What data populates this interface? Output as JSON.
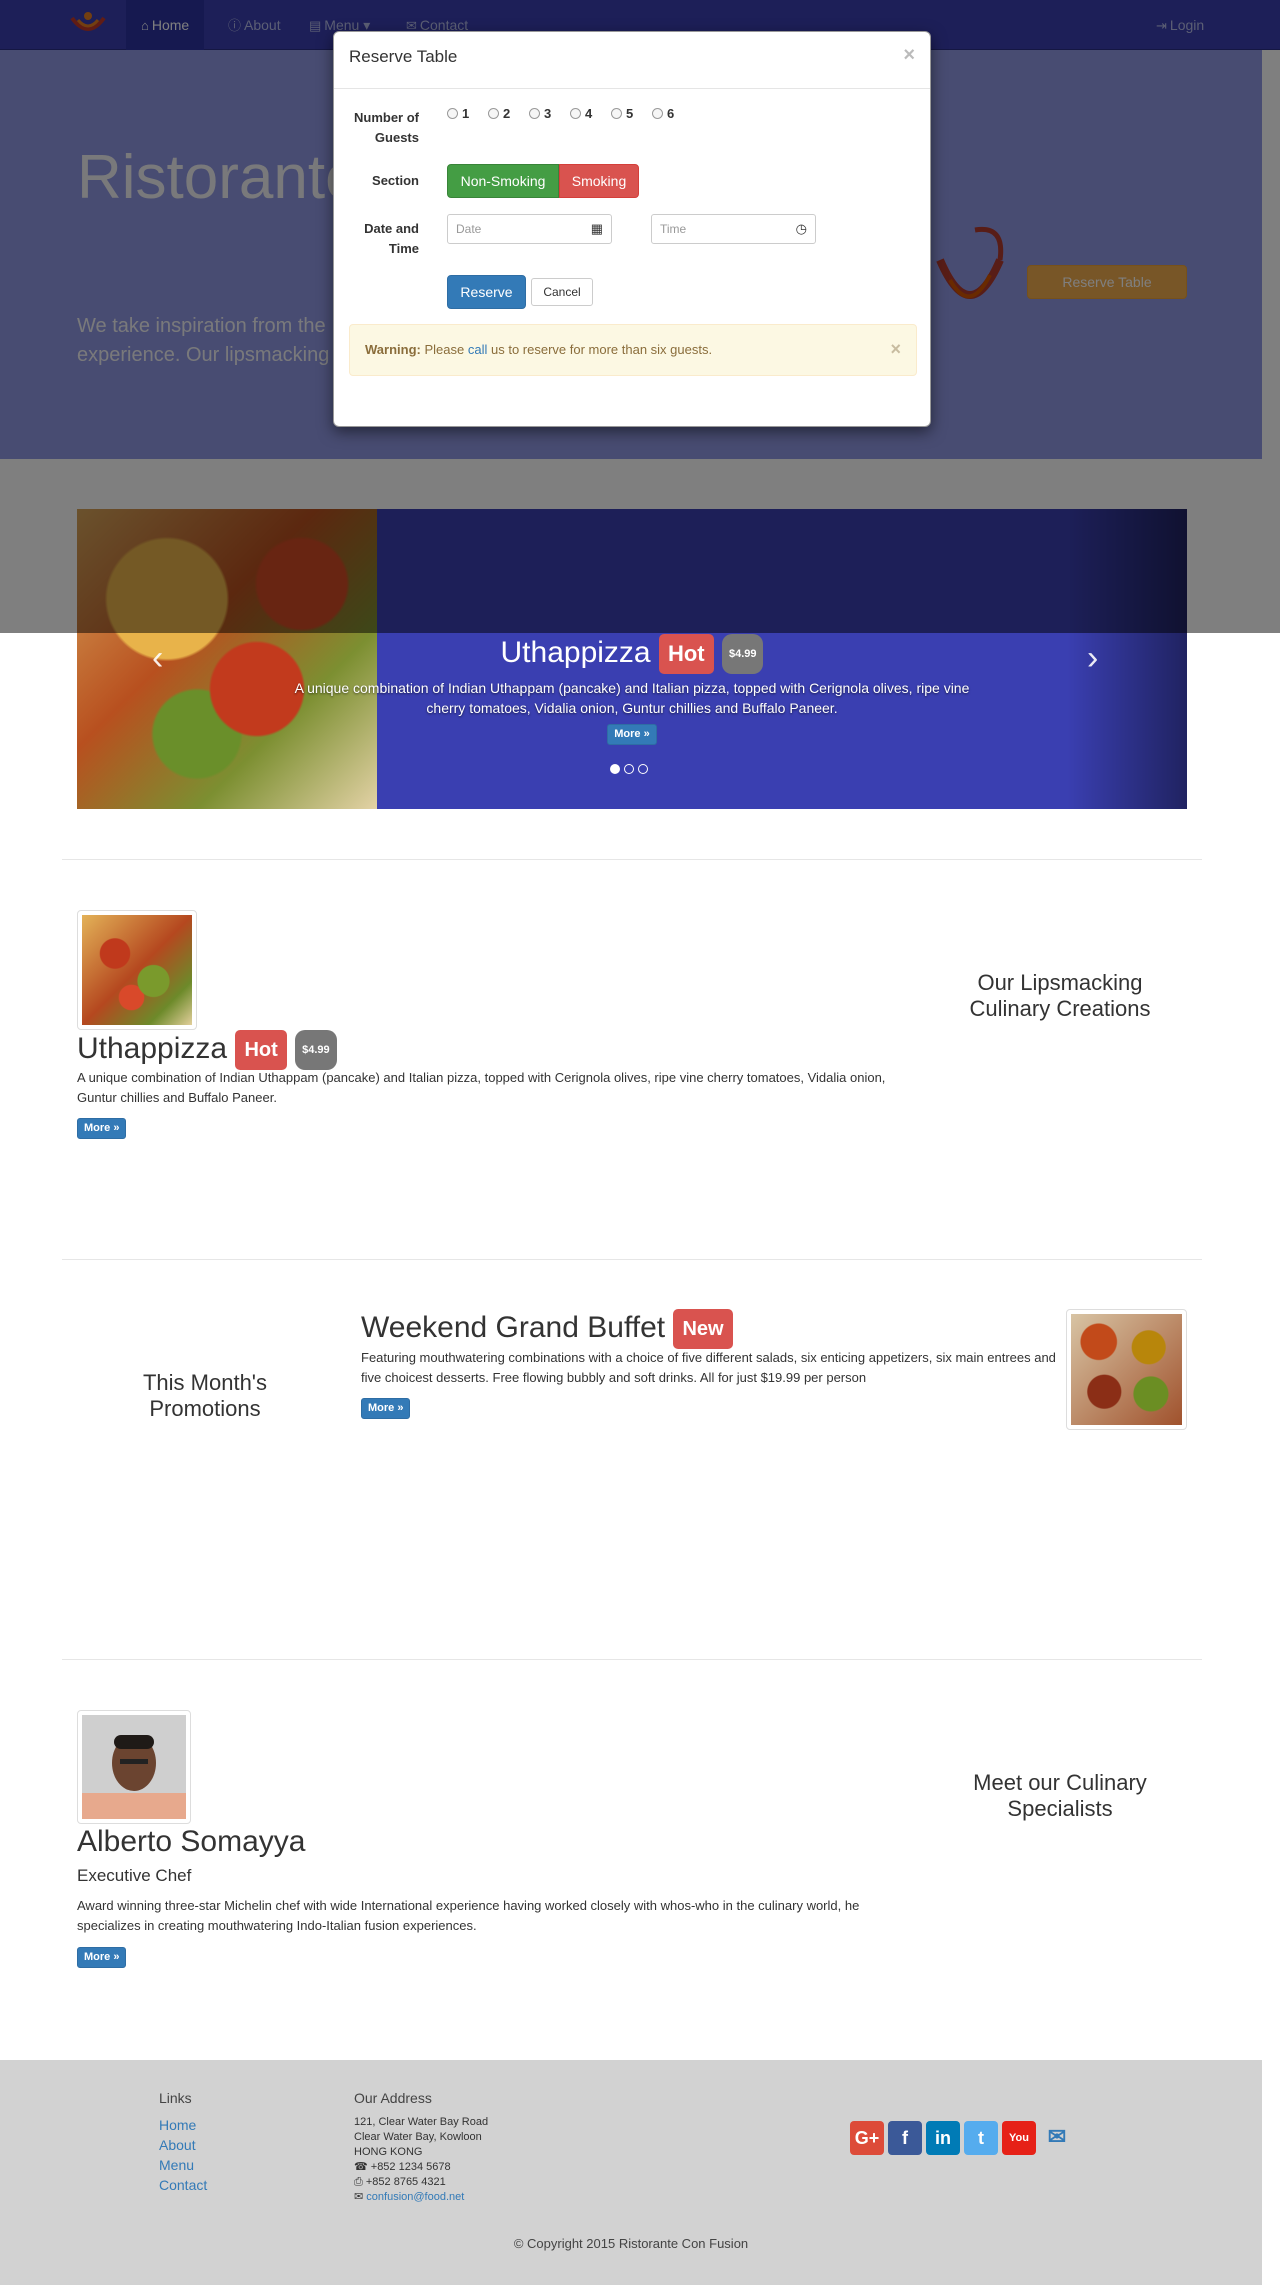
{
  "nav": {
    "home": "Home",
    "about": "About",
    "menu": "Menu",
    "contact": "Contact",
    "login": "Login",
    "icons": {
      "home": "home-icon",
      "about": "info-icon",
      "menu": "list-icon",
      "contact": "envelope-icon",
      "login": "login-icon"
    }
  },
  "jumbotron": {
    "title": "Ristorante",
    "text": "We take inspiration from the World's best cuisines, and create a unique fusion experience. Our lipsmacking creations will tickle your culinary senses!",
    "text_visible_1": "We take inspiration from the",
    "text_visible_2": "experience. Our lipsmacking",
    "reserve_button": "Reserve Table"
  },
  "carousel": {
    "title": "Uthappizza",
    "label": "Hot",
    "price": "$4.99",
    "description": "A unique combination of Indian Uthappam (pancake) and Italian pizza, topped with Cerignola olives, ripe vine cherry tomatoes, Vidalia onion, Guntur chillies and Buffalo Paneer.",
    "more": "More »"
  },
  "dish": {
    "name": "Uthappizza",
    "label": "Hot",
    "price": "$4.99",
    "description": "A unique combination of Indian Uthappam (pancake) and Italian pizza, topped with Cerignola olives, ripe vine cherry tomatoes, Vidalia onion, Guntur chillies and Buffalo Paneer.",
    "more": "More »",
    "side_heading": "Our Lipsmacking Culinary Creations"
  },
  "promotion": {
    "name": "Weekend Grand Buffet",
    "label": "New",
    "description": "Featuring mouthwatering combinations with a choice of five different salads, six enticing appetizers, six main entrees and five choicest desserts. Free flowing bubbly and soft drinks. All for just $19.99 per person",
    "more": "More »",
    "side_heading": "This Month's Promotions"
  },
  "chef": {
    "name": "Alberto Somayya",
    "role": "Executive Chef",
    "description": "Award winning three-star Michelin chef with wide International experience having worked closely with whos-who in the culinary world, he specializes in creating mouthwatering Indo-Italian fusion experiences.",
    "more": "More »",
    "side_heading": "Meet our Culinary Specialists"
  },
  "footer": {
    "links_heading": "Links",
    "links": [
      "Home",
      "About",
      "Menu",
      "Contact"
    ],
    "address_heading": "Our Address",
    "address": [
      "121, Clear Water Bay Road",
      "Clear Water Bay, Kowloon",
      "HONG KONG"
    ],
    "phone": "+852 1234 5678",
    "fax": "+852 8765 4321",
    "email": "confusion@food.net",
    "social": {
      "google": "G+",
      "facebook": "f",
      "linkedin": "in",
      "twitter": "t",
      "youtube": "You"
    },
    "copyright": "© Copyright 2015 Ristorante Con Fusion"
  },
  "modal": {
    "title": "Reserve Table",
    "close": "×",
    "guests_label": "Number of Guests",
    "guests_options": [
      "1",
      "2",
      "3",
      "4",
      "5",
      "6"
    ],
    "section_label": "Section",
    "non_smoking": "Non-Smoking",
    "smoking": "Smoking",
    "datetime_label": "Date and Time",
    "date_placeholder": "Date",
    "time_placeholder": "Time",
    "reserve": "Reserve",
    "cancel": "Cancel",
    "alert_strong": "Warning:",
    "alert_pre": "Please",
    "alert_link": "call",
    "alert_post": "us to reserve for more than six guests.",
    "alert_close": "×"
  },
  "colors": {
    "navbar": "#3a3fb1",
    "jumbotron": "#9199e4",
    "accent_orange": "#f0ad4e",
    "success": "#449d44",
    "danger": "#d9534f",
    "primary": "#337ab7"
  }
}
